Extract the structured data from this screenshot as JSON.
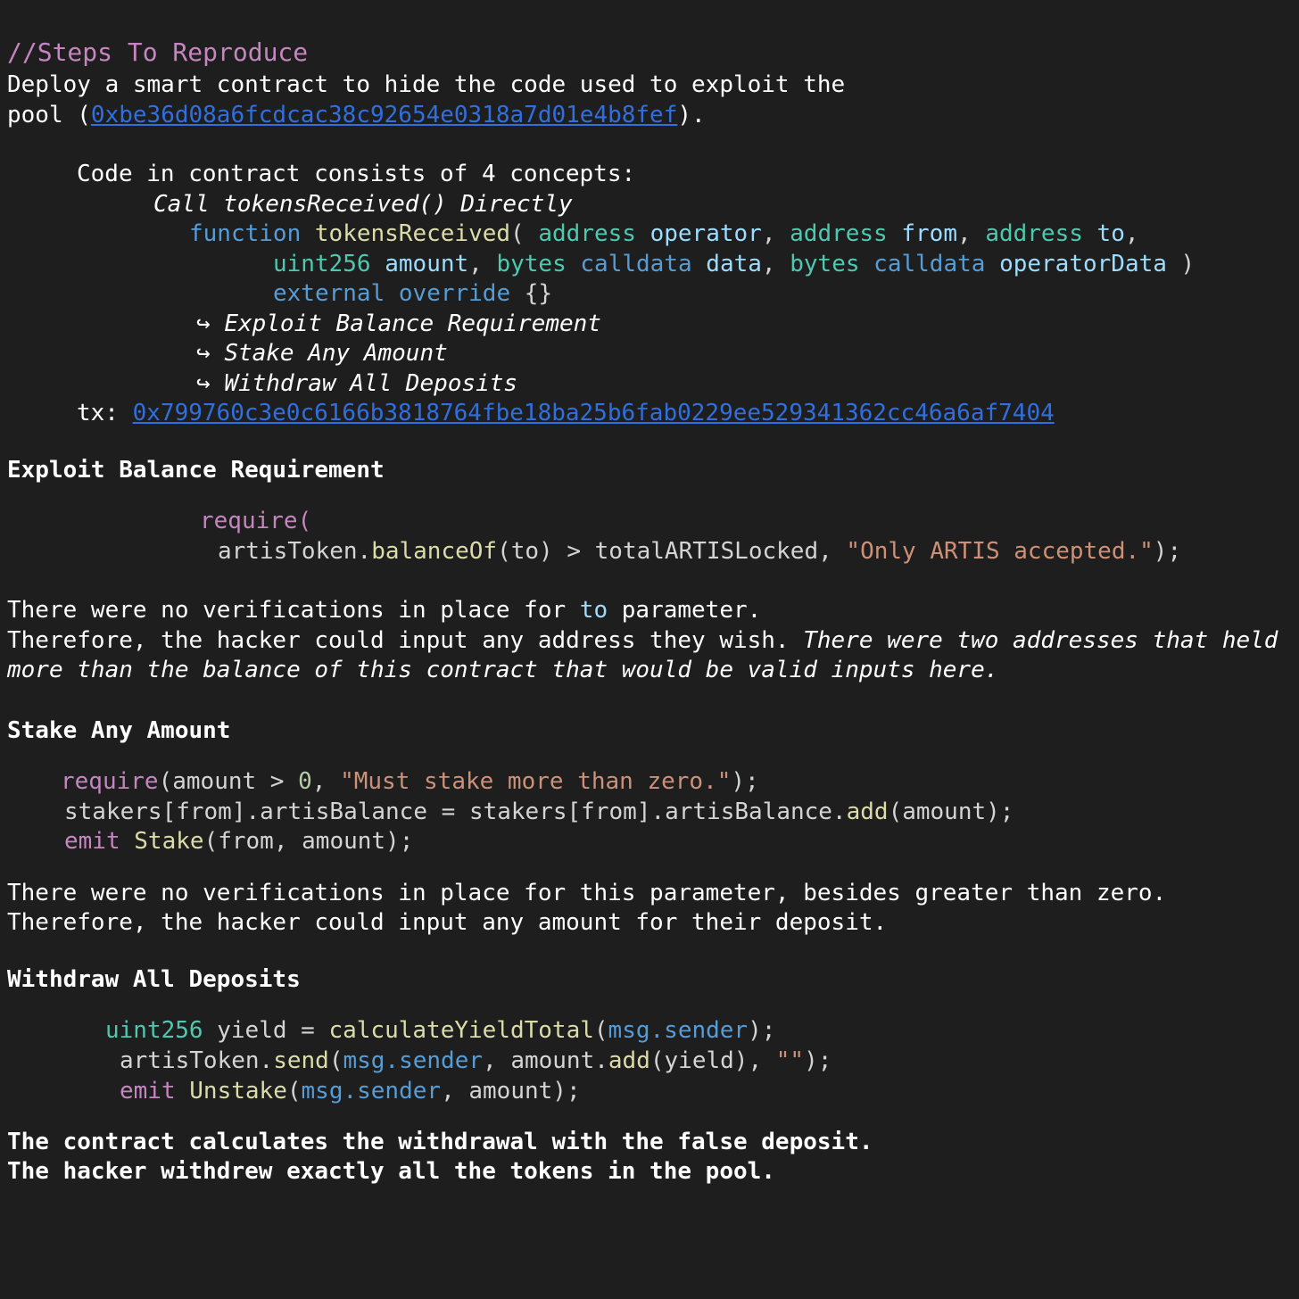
{
  "steps": {
    "heading": "//Steps To Reproduce",
    "intro_line1": "Deploy a smart contract to hide the code used to exploit the",
    "intro_line2_prefix": "pool (",
    "pool_address": "0xbe36d08a6fcdcac38c92654e0318a7d01e4b8fef",
    "intro_line2_suffix": ").",
    "concepts_intro": "Code in contract consists of 4 concepts:",
    "call_direct": "Call tokensReceived() Directly",
    "fn_sig": {
      "kw_function": "function",
      "name": "tokensReceived",
      "open": "( ",
      "t_address": "address",
      "p_operator": "operator",
      "p_from": "from",
      "p_to": "to",
      "comma": ", ",
      "comma_end": ",",
      "t_uint256": "uint256",
      "p_amount": "amount",
      "t_bytes": "bytes",
      "kw_calldata": "calldata",
      "p_data": "data",
      "p_operatorData": "operatorData",
      "close": " )",
      "kw_external": "external",
      "kw_override": "override",
      "braces": "{}"
    },
    "arrow": "↪",
    "sub_items": [
      "Exploit Balance Requirement",
      "Stake Any Amount",
      "Withdraw All Deposits"
    ],
    "tx_label": "tx: ",
    "tx_hash": "0x799760c3e0c6166b3818764fbe18ba25b6fab0229ee529341362cc46a6af7404"
  },
  "section1": {
    "heading": "Exploit Balance Requirement",
    "code": {
      "require_open": "require(",
      "obj": "artisToken.",
      "method": "balanceOf",
      "args": "(to) > totalARTISLocked, ",
      "msg": "\"Only ARTIS accepted.\"",
      "end": ");"
    },
    "text_line1_prefix": "There were no verifications in place for ",
    "text_line1_var": "to",
    "text_line1_suffix": " parameter.",
    "text_line2_plain": "Therefore, the hacker could input any address they wish. ",
    "text_line2_italic": "There were two addresses that held",
    "text_line3_italic": "more than the balance of this contract that would be valid inputs here."
  },
  "section2": {
    "heading": "Stake Any Amount",
    "code": {
      "require": "require",
      "args_a": "(amount > ",
      "zero": "0",
      "comma": ", ",
      "msg": "\"Must stake more than zero.\"",
      "end": ");",
      "line2_a": "stakers[from].artisBalance = stakers[from].artisBalance.",
      "line2_add": "add",
      "line2_b": "(amount);",
      "emit": "emit",
      "event": "Stake",
      "event_args": "(from, amount);"
    },
    "text_line1": "There were no verifications in place for this parameter, besides greater than zero.",
    "text_line2": "Therefore, the hacker could input any amount for their deposit."
  },
  "section3": {
    "heading": "Withdraw All Deposits",
    "code": {
      "t_uint256": "uint256",
      "yield_assign": " yield = ",
      "fn_calc": "calculateYieldTotal",
      "paren_open": "(",
      "msg_sender": "msg.sender",
      "paren_close_end": ");",
      "obj": "artisToken.",
      "send": "send",
      "comma": ", amount.",
      "add": "add",
      "yield_args": "(yield), ",
      "empty_str": "\"\"",
      "end": ");",
      "emit": "emit",
      "event": "Unstake",
      "event_args_end": ", amount);"
    },
    "text_line1": "The contract calculates the withdrawal with the false deposit.",
    "text_line2": "The hacker withdrew exactly all the tokens in the pool."
  },
  "colors": {
    "background": "#1e1e1e",
    "comment": "#c586c0",
    "link": "#2f6fe0",
    "keyword": "#569cd6",
    "type": "#4ec9b0",
    "function": "#dcdcaa",
    "variable": "#9cdcfe",
    "string": "#ce9178"
  }
}
